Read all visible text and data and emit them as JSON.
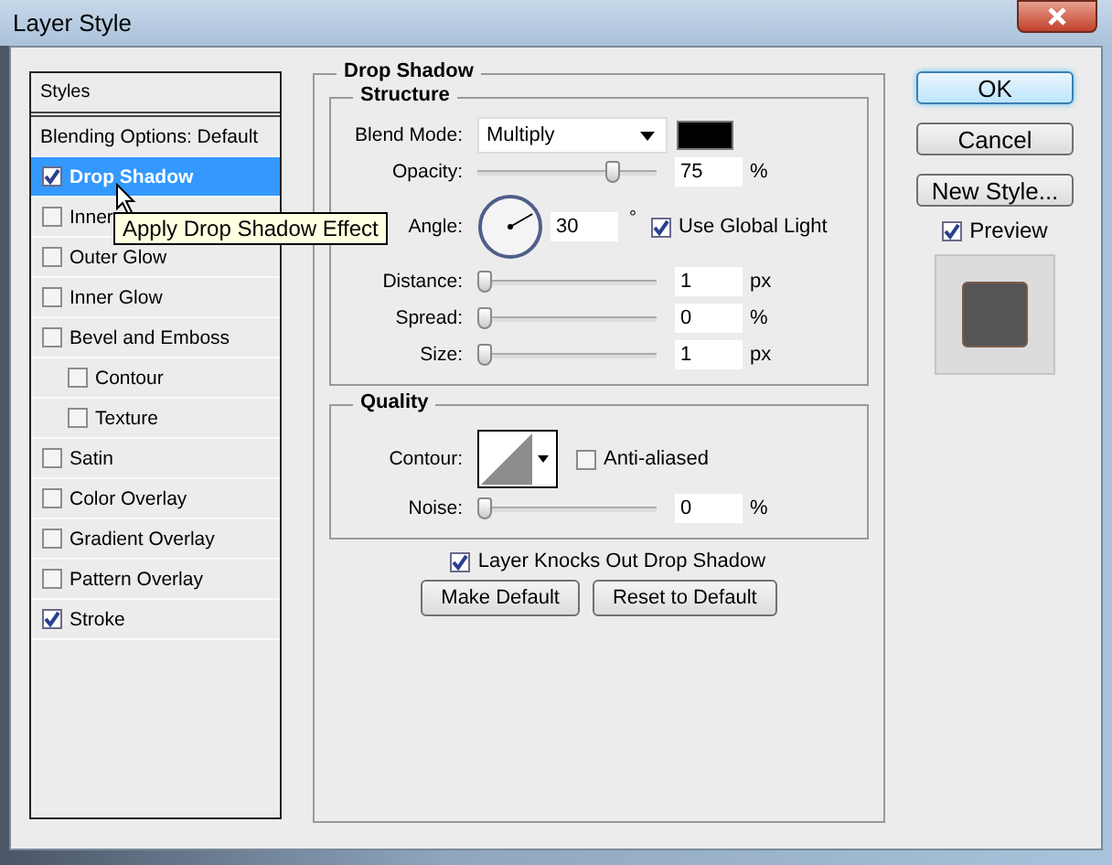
{
  "window": {
    "title": "Layer Style"
  },
  "styles_panel": {
    "header": "Styles",
    "blending": "Blending Options: Default",
    "items": [
      {
        "label": "Drop Shadow",
        "checked": true,
        "selected": true
      },
      {
        "label": "Inner",
        "checked": false,
        "selected": false
      },
      {
        "label": "Outer Glow",
        "checked": false,
        "selected": false
      },
      {
        "label": "Inner Glow",
        "checked": false,
        "selected": false
      },
      {
        "label": "Bevel and Emboss",
        "checked": false,
        "selected": false,
        "children": [
          {
            "label": "Contour",
            "checked": false,
            "selected": false
          },
          {
            "label": "Texture",
            "checked": false,
            "selected": false
          }
        ]
      },
      {
        "label": "Satin",
        "checked": false,
        "selected": false
      },
      {
        "label": "Color Overlay",
        "checked": false,
        "selected": false
      },
      {
        "label": "Gradient Overlay",
        "checked": false,
        "selected": false
      },
      {
        "label": "Pattern Overlay",
        "checked": false,
        "selected": false
      },
      {
        "label": "Stroke",
        "checked": true,
        "selected": false
      }
    ]
  },
  "tooltip": "Apply Drop Shadow Effect",
  "drop_shadow": {
    "title": "Drop Shadow",
    "structure": {
      "title": "Structure",
      "blend_mode": {
        "label": "Blend Mode:",
        "value": "Multiply"
      },
      "opacity": {
        "label": "Opacity:",
        "level": 0.78,
        "value": "75",
        "unit": "%"
      },
      "angle": {
        "label": "Angle:",
        "value": "30",
        "unit": "°",
        "global_light": {
          "label": "Use Global Light",
          "checked": true
        }
      },
      "sliders": [
        {
          "label": "Distance:",
          "level": 0,
          "value": "1",
          "unit": "px"
        },
        {
          "label": "Spread:",
          "level": 0,
          "value": "0",
          "unit": "%"
        },
        {
          "label": "Size:",
          "level": 0,
          "value": "1",
          "unit": "px"
        }
      ]
    },
    "quality": {
      "title": "Quality",
      "contour": {
        "label": "Contour:"
      },
      "anti_aliased": {
        "label": "Anti-aliased",
        "checked": false
      },
      "noise": {
        "label": "Noise:",
        "level": 0,
        "value": "0",
        "unit": "%"
      }
    },
    "knockout": {
      "label": "Layer Knocks Out Drop Shadow",
      "checked": true
    },
    "buttons": [
      "Make Default",
      "Reset to Default"
    ]
  },
  "actions": [
    {
      "label": "OK",
      "default": true
    },
    {
      "label": "Cancel",
      "default": false
    },
    {
      "label": "New Style...",
      "default": false
    }
  ],
  "preview": {
    "label": "Preview",
    "checked": true
  }
}
